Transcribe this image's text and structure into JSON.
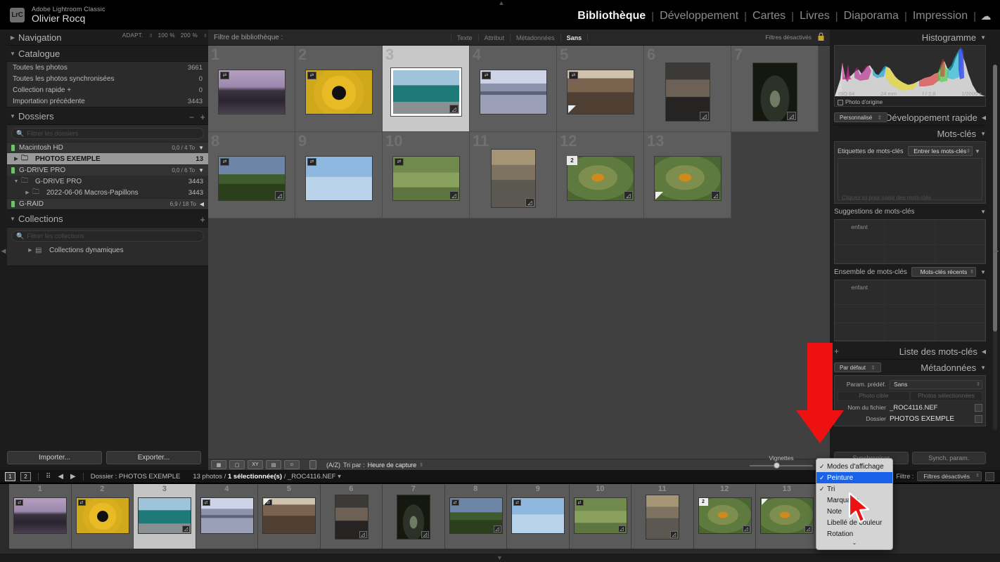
{
  "app": {
    "logo": "LrC",
    "product": "Adobe Lightroom Classic",
    "user": "Olivier Rocq"
  },
  "modules": [
    {
      "label": "Bibliothèque",
      "active": true
    },
    {
      "label": "Développement",
      "active": false
    },
    {
      "label": "Cartes",
      "active": false
    },
    {
      "label": "Livres",
      "active": false
    },
    {
      "label": "Diaporama",
      "active": false
    },
    {
      "label": "Impression",
      "active": false
    }
  ],
  "module_separator": "|",
  "cloud_icon": "cloud-icon",
  "left_panel": {
    "navigator": {
      "title": "Navigation",
      "fit": "ADAPT.",
      "zoom_100": "100 %",
      "zoom_200": "200 %"
    },
    "catalog": {
      "title": "Catalogue",
      "items": [
        {
          "label": "Toutes les photos",
          "count": "3661"
        },
        {
          "label": "Toutes les photos synchronisées",
          "count": "0"
        },
        {
          "label": "Collection rapide +",
          "count": "0"
        },
        {
          "label": "Importation précédente",
          "count": "3443"
        }
      ]
    },
    "folders": {
      "title": "Dossiers",
      "search_placeholder": "Filtrer les dossiers",
      "volumes": [
        {
          "name": "Macintosh HD",
          "space": "0,0 / 4 To",
          "state": "expanded"
        },
        {
          "name": "G-DRIVE PRO",
          "space": "0,0 / 6 To",
          "state": "expanded"
        },
        {
          "name": "G-RAID",
          "space": "6,9 / 18 To",
          "state": "collapsed"
        }
      ],
      "rows": [
        {
          "label": "PHOTOS EXEMPLE",
          "count": "13",
          "selected": true,
          "indent": 1
        },
        {
          "label": "G-DRIVE PRO",
          "count": "3443",
          "selected": false,
          "indent": 1
        },
        {
          "label": "2022-06-06 Macros-Papillons",
          "count": "3443",
          "selected": false,
          "indent": 2
        }
      ]
    },
    "collections": {
      "title": "Collections",
      "search_placeholder": "Filtrer les collections",
      "items": [
        {
          "label": "Collections dynamiques"
        }
      ]
    },
    "buttons": {
      "import": "Importer...",
      "export": "Exporter..."
    }
  },
  "library_filter": {
    "label": "Filtre de bibliothèque :",
    "tabs": [
      {
        "label": "Texte",
        "active": false
      },
      {
        "label": "Attribut",
        "active": false
      },
      {
        "label": "Métadonnées",
        "active": false
      },
      {
        "label": "Sans",
        "active": true
      }
    ],
    "status": "Filtres désactivés",
    "lock_icon": "lock-icon"
  },
  "grid": {
    "cells": [
      {
        "index": "1",
        "selected": false,
        "badge_tl": "sync-icon",
        "badge_num": null,
        "badge_br": null,
        "badge_tri": false,
        "orientation": "landscape",
        "subject": "city-skyline-dusk"
      },
      {
        "index": "2",
        "selected": false,
        "badge_tl": "sync-icon",
        "badge_num": null,
        "badge_br": null,
        "badge_tri": false,
        "orientation": "landscape",
        "subject": "yellow-abstract-star"
      },
      {
        "index": "3",
        "selected": true,
        "badge_tl": null,
        "badge_num": null,
        "badge_br": "edit-icon",
        "badge_tri": false,
        "orientation": "landscape",
        "subject": "teal-vw-beetle-car"
      },
      {
        "index": "4",
        "selected": false,
        "badge_tl": "sync-icon",
        "badge_num": null,
        "badge_br": null,
        "badge_tri": false,
        "orientation": "landscape",
        "subject": "river-town-reflection"
      },
      {
        "index": "5",
        "selected": false,
        "badge_tl": "sync-icon",
        "badge_num": null,
        "badge_br": null,
        "badge_tri": true,
        "orientation": "landscape",
        "subject": "desert-rock-formation"
      },
      {
        "index": "6",
        "selected": false,
        "badge_tl": null,
        "badge_num": null,
        "badge_br": "edit-icon",
        "badge_tri": false,
        "orientation": "portrait",
        "subject": "ostrich-head"
      },
      {
        "index": "7",
        "selected": false,
        "badge_tl": null,
        "badge_num": null,
        "badge_br": "edit-icon",
        "badge_tri": false,
        "orientation": "portrait",
        "subject": "dark-tunnel-arch"
      },
      {
        "index": "8",
        "selected": false,
        "badge_tl": "sync-icon",
        "badge_num": null,
        "badge_br": "edit-icon",
        "badge_tri": false,
        "orientation": "landscape",
        "subject": "green-field-sunset"
      },
      {
        "index": "9",
        "selected": false,
        "badge_tl": "sync-icon",
        "badge_num": null,
        "badge_br": null,
        "badge_tri": false,
        "orientation": "landscape",
        "subject": "eagle-flying-blue-sky"
      },
      {
        "index": "10",
        "selected": false,
        "badge_tl": "sync-icon",
        "badge_num": null,
        "badge_br": "edit-icon",
        "badge_tri": false,
        "orientation": "landscape",
        "subject": "child-in-field"
      },
      {
        "index": "11",
        "selected": false,
        "badge_tl": null,
        "badge_num": null,
        "badge_br": "edit-icon",
        "badge_tri": false,
        "orientation": "portrait",
        "subject": "smiling-blonde-woman"
      },
      {
        "index": "12",
        "selected": false,
        "badge_tl": null,
        "badge_num": "2",
        "badge_br": "edit-icon",
        "badge_tri": false,
        "orientation": "landscape",
        "subject": "butterfly-macro"
      },
      {
        "index": "13",
        "selected": false,
        "badge_tl": null,
        "badge_num": null,
        "badge_br": "edit-icon",
        "badge_tri": true,
        "orientation": "landscape",
        "subject": "butterfly-macro"
      }
    ]
  },
  "toolbar": {
    "icons": [
      "grid-view-icon",
      "loupe-view-icon",
      "compare-view-icon",
      "survey-view-icon",
      "people-view-icon",
      "spray-can-icon",
      "sort-direction-icon"
    ],
    "sort_label": "Tri par :",
    "sort_value": "Heure de capture",
    "thumbnail_label": "Vignettes",
    "thumbnail_slider_pct": 38,
    "caret": "caret-down-icon"
  },
  "right_panel": {
    "histogram": {
      "title": "Histogramme",
      "iso": "ISO 64",
      "focal": "24 mm",
      "aperture": "f / 2,8",
      "shutter": "1/2000 s",
      "original_checkbox": "Photo d'origine"
    },
    "quick_develop": {
      "title": "Développement rapide",
      "preset": "Personnalisé"
    },
    "keywords": {
      "title": "Mots-clés",
      "tags_label": "Etiquettes de mots-clés",
      "tags_value": "Entrer les mots-clés",
      "placeholder": "Cliquez ici pour saisir des mots-clés"
    },
    "keyword_suggestions": {
      "title": "Suggestions de mots-clés",
      "items": [
        "enfant",
        "",
        "",
        "",
        "",
        ""
      ]
    },
    "keyword_set": {
      "title": "Ensemble de mots-clés",
      "selected": "Mots-clés récents",
      "items": [
        "enfant",
        "",
        "",
        "",
        "",
        "",
        "",
        "",
        ""
      ]
    },
    "keyword_list": {
      "title": "Liste des mots-clés"
    },
    "metadata": {
      "title": "Métadonnées",
      "preset_left": "Par défaut",
      "preset_label": "Param. prédéf.",
      "preset_value": "Sans",
      "target_photo": "Photo cible",
      "selected_photos": "Photos sélectionnées",
      "filename_label": "Nom du fichier",
      "filename_value": "_ROC4116.NEF",
      "folder_label": "Dossier",
      "folder_value": "PHOTOS EXEMPLE"
    },
    "buttons": {
      "left": "Synchroniser",
      "right": "Synch. param."
    }
  },
  "filmstrip_header": {
    "screen1": "1",
    "screen2": "2",
    "grid_icon": "grid-icon",
    "back_icon": "arrow-left-icon",
    "forward_icon": "arrow-right-icon",
    "source": "Dossier : PHOTOS EXEMPLE",
    "counts_prefix": "13 photos /",
    "counts_selected": "1 sélectionnée(s)",
    "counts_suffix": "/ _ROC4116.NEF",
    "filter_label": "Filtre :",
    "filter_value": "Filtres désactivés"
  },
  "filmstrip": {
    "cells": [
      {
        "index": "1",
        "selected": false,
        "badge_tl": "sync-icon",
        "badge_num": null,
        "badge_br": null,
        "badge_tri": false,
        "orientation": "landscape",
        "subject": "city-skyline-dusk"
      },
      {
        "index": "2",
        "selected": false,
        "badge_tl": "sync-icon",
        "badge_num": null,
        "badge_br": null,
        "badge_tri": false,
        "orientation": "landscape",
        "subject": "yellow-abstract-star"
      },
      {
        "index": "3",
        "selected": true,
        "badge_tl": null,
        "badge_num": null,
        "badge_br": "edit-icon",
        "badge_tri": false,
        "orientation": "landscape",
        "subject": "teal-vw-beetle-car"
      },
      {
        "index": "4",
        "selected": false,
        "badge_tl": "sync-icon",
        "badge_num": null,
        "badge_br": null,
        "badge_tri": false,
        "orientation": "landscape",
        "subject": "river-town-reflection"
      },
      {
        "index": "5",
        "selected": false,
        "badge_tl": "sync-icon",
        "badge_num": null,
        "badge_br": null,
        "badge_tri": true,
        "orientation": "landscape",
        "subject": "desert-rock-formation"
      },
      {
        "index": "6",
        "selected": false,
        "badge_tl": null,
        "badge_num": null,
        "badge_br": "edit-icon",
        "badge_tri": false,
        "orientation": "portrait",
        "subject": "ostrich-head"
      },
      {
        "index": "7",
        "selected": false,
        "badge_tl": null,
        "badge_num": null,
        "badge_br": "edit-icon",
        "badge_tri": false,
        "orientation": "portrait",
        "subject": "dark-tunnel-arch"
      },
      {
        "index": "8",
        "selected": false,
        "badge_tl": "sync-icon",
        "badge_num": null,
        "badge_br": "edit-icon",
        "badge_tri": false,
        "orientation": "landscape",
        "subject": "green-field-sunset"
      },
      {
        "index": "9",
        "selected": false,
        "badge_tl": "sync-icon",
        "badge_num": null,
        "badge_br": null,
        "badge_tri": false,
        "orientation": "landscape",
        "subject": "eagle-flying-blue-sky"
      },
      {
        "index": "10",
        "selected": false,
        "badge_tl": "sync-icon",
        "badge_num": null,
        "badge_br": "edit-icon",
        "badge_tri": false,
        "orientation": "landscape",
        "subject": "child-in-field"
      },
      {
        "index": "11",
        "selected": false,
        "badge_tl": null,
        "badge_num": null,
        "badge_br": "edit-icon",
        "badge_tri": false,
        "orientation": "portrait",
        "subject": "smiling-blonde-woman"
      },
      {
        "index": "12",
        "selected": false,
        "badge_tl": null,
        "badge_num": "2",
        "badge_br": "edit-icon",
        "badge_tri": false,
        "orientation": "landscape",
        "subject": "butterfly-macro"
      },
      {
        "index": "13",
        "selected": false,
        "badge_tl": null,
        "badge_num": null,
        "badge_br": "edit-icon",
        "badge_tri": true,
        "orientation": "landscape",
        "subject": "butterfly-macro"
      }
    ]
  },
  "context_menu": {
    "items": [
      {
        "label": "Modes d'affichage",
        "checked": true,
        "highlighted": false
      },
      {
        "label": "Peinture",
        "checked": true,
        "highlighted": true
      },
      {
        "label": "Tri",
        "checked": true,
        "highlighted": false
      },
      {
        "label": "Marquage",
        "checked": false,
        "highlighted": false
      },
      {
        "label": "Note",
        "checked": false,
        "highlighted": false
      },
      {
        "label": "Libellé de couleur",
        "checked": false,
        "highlighted": false
      },
      {
        "label": "Rotation",
        "checked": false,
        "highlighted": false
      }
    ],
    "more_icon": "chevron-down-icon"
  },
  "annotation": {
    "arrow_color": "#ee1111",
    "arrow_name": "red-down-arrow"
  },
  "colors": {
    "accent_blue": "#1a63e8",
    "panel_bg": "#1c1c1c",
    "grid_bg": "#404040",
    "selected_cell": "#c8c8c8"
  }
}
